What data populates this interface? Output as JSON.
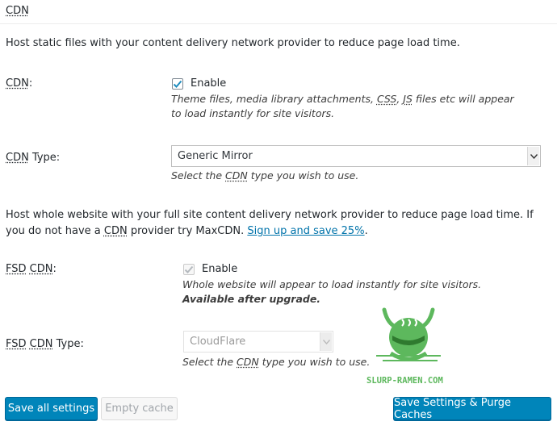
{
  "section": {
    "title": "CDN"
  },
  "cdn_description": "Host static files with your content delivery network provider to reduce page load time.",
  "cdn": {
    "label": "CDN",
    "label_suffix": ":",
    "checkbox_label": "Enable",
    "checked": true,
    "help_1": "Theme files, media library attachments, ",
    "help_css": "CSS",
    "help_2": ", ",
    "help_js": "JS",
    "help_3": " files etc will appear to load instantly for site visitors."
  },
  "cdn_type": {
    "label_abbr": "CDN",
    "label_rest": " Type:",
    "selected": "Generic Mirror",
    "help_1": "Select the ",
    "help_abbr": "CDN",
    "help_2": " type you wish to use."
  },
  "fsd_description": {
    "text_1": "Host whole website with your full site content delivery network provider to reduce page load time. If you do not have a ",
    "abbr": "CDN",
    "text_2": " provider try MaxCDN. ",
    "link": "Sign up and save 25%",
    "text_3": "."
  },
  "fsd_cdn": {
    "label_abbr_1": "FSD",
    "label_abbr_2": "CDN",
    "label_suffix": ":",
    "checkbox_label": "Enable",
    "checked": true,
    "help_normal": "Whole website will appear to load instantly for site visitors. ",
    "help_bold": "Available after upgrade."
  },
  "fsd_cdn_type": {
    "label_abbr_1": "FSD",
    "label_abbr_2": "CDN",
    "label_rest": " Type:",
    "selected": "CloudFlare",
    "help_1": "Select the ",
    "help_abbr": "CDN",
    "help_2": " type you wish to use."
  },
  "watermark": {
    "text": "SLURP-RAMEN.COM",
    "color": "#5db85d"
  },
  "buttons": {
    "save_all": "Save all settings",
    "empty_cache": "Empty cache",
    "save_purge": "Save Settings & Purge Caches"
  },
  "colors": {
    "primary": "#0085ba",
    "link": "#0073aa"
  }
}
